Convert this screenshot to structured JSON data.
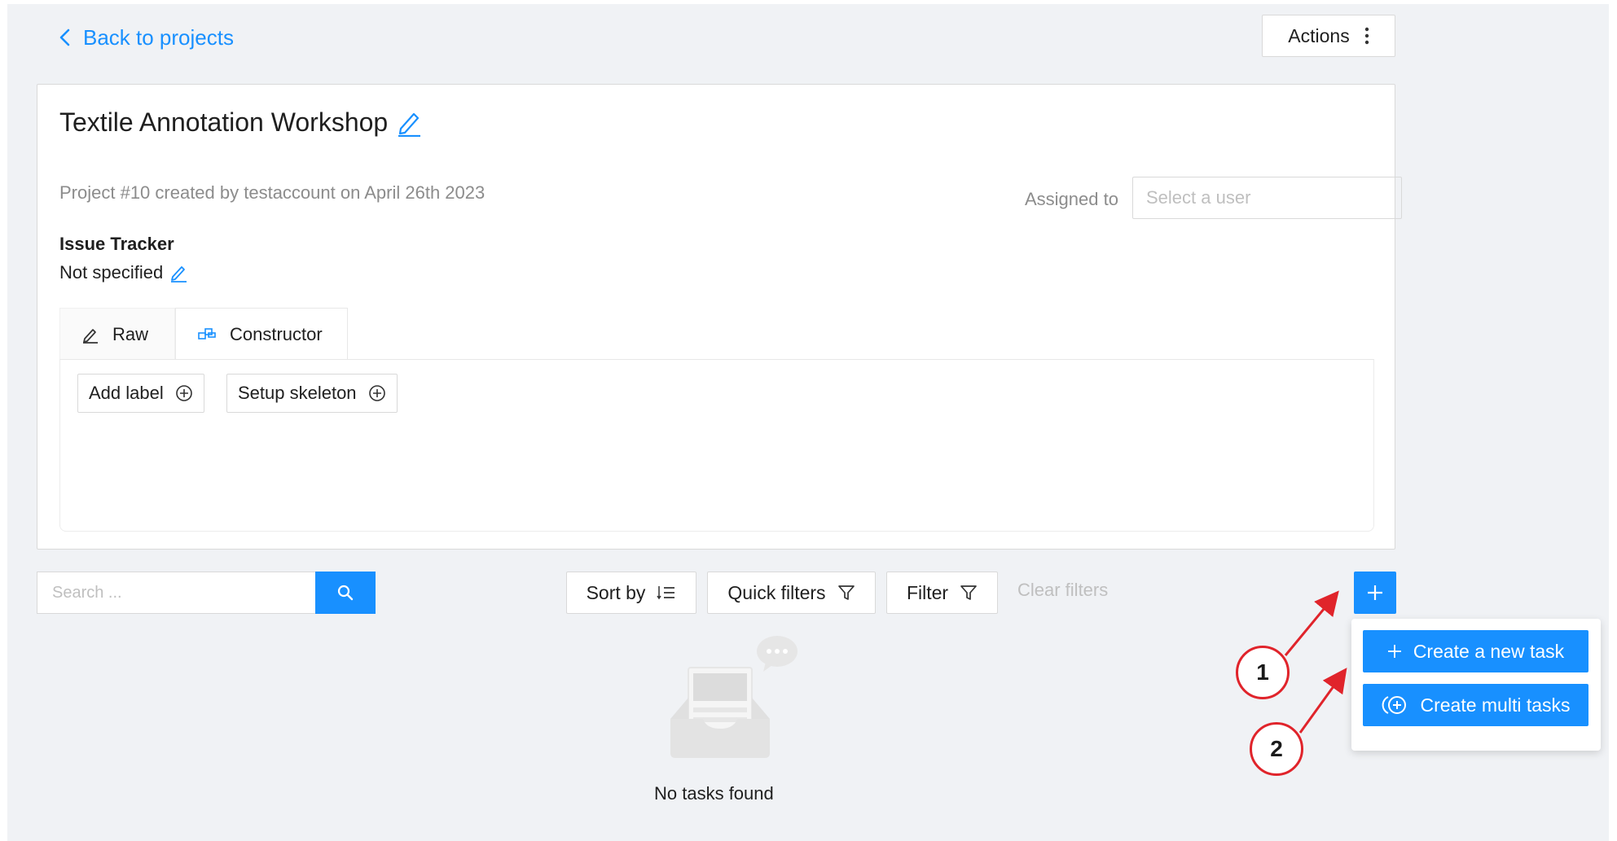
{
  "nav": {
    "back_label": "Back to projects"
  },
  "header": {
    "actions_label": "Actions"
  },
  "project": {
    "title": "Textile Annotation Workshop",
    "meta": "Project #10 created by testaccount on April 26th 2023",
    "assigned_label": "Assigned to",
    "assignee_placeholder": "Select a user",
    "issue_tracker_label": "Issue Tracker",
    "issue_tracker_value": "Not specified"
  },
  "tabs": [
    {
      "label": "Raw",
      "icon": "pencil-icon",
      "active": false
    },
    {
      "label": "Constructor",
      "icon": "constructor-icon",
      "active": true
    }
  ],
  "constructor": {
    "add_label": "Add label",
    "setup_skeleton": "Setup skeleton"
  },
  "toolbar": {
    "search_placeholder": "Search ...",
    "sort_label": "Sort by",
    "quick_filters_label": "Quick filters",
    "filter_label": "Filter",
    "clear_filters_label": "Clear filters"
  },
  "create_menu": {
    "create_task_label": "Create a new task",
    "create_multi_label": "Create multi tasks"
  },
  "empty_state": {
    "message": "No tasks found"
  },
  "annotations": {
    "callout_1": "1",
    "callout_2": "2"
  },
  "colors": {
    "primary": "#1890ff",
    "callout": "#e0242b",
    "background": "#f0f2f5"
  }
}
